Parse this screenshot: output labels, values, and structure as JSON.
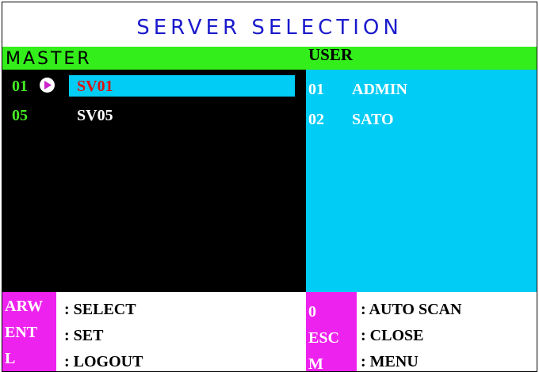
{
  "header": {
    "title": "SERVER SELECTION"
  },
  "master": {
    "label": "MASTER",
    "rows": [
      {
        "num": "01",
        "name": "SV01",
        "selected": true
      },
      {
        "num": "05",
        "name": "SV05",
        "selected": false
      }
    ]
  },
  "user": {
    "label": "USER",
    "rows": [
      {
        "num": "01",
        "name": "ADMIN"
      },
      {
        "num": "02",
        "name": "SATO"
      }
    ]
  },
  "footer": {
    "left": [
      {
        "key": "ARW",
        "desc": ": SELECT"
      },
      {
        "key": "ENT",
        "desc": ": SET"
      },
      {
        "key": "L",
        "desc": ": LOGOUT"
      }
    ],
    "right": [
      {
        "key": "0",
        "desc": ": AUTO SCAN"
      },
      {
        "key": "ESC",
        "desc": ": CLOSE"
      },
      {
        "key": "M",
        "desc": ": MENU"
      }
    ]
  },
  "colors": {
    "title": "#1a1acc",
    "header_bar": "#33ee1a",
    "user_panel": "#00ccf5",
    "selection": "#00ccf5",
    "selected_text": "#dd1111",
    "number_text": "#44ee22",
    "key_badge": "#ee22ee",
    "cursor_arrow": "#cc22cc"
  },
  "icons": {
    "cursor": "play-arrow-icon"
  }
}
